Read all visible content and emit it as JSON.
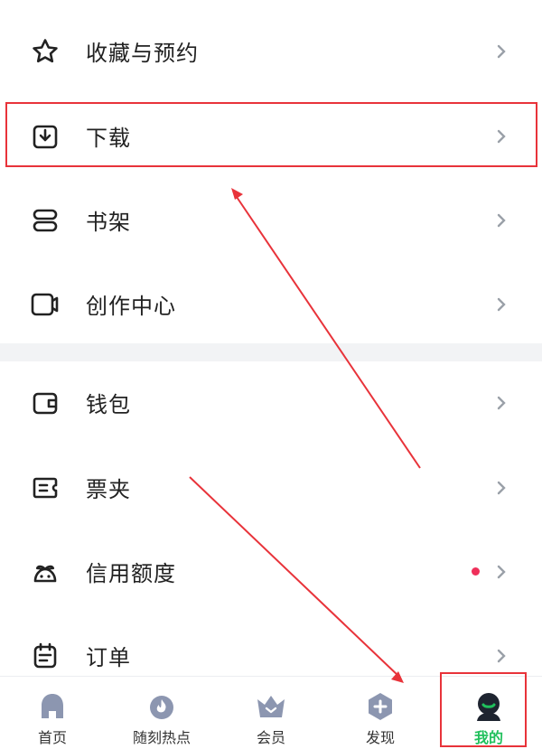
{
  "menu": {
    "items": [
      {
        "label": "收藏与预约",
        "icon": "star-icon"
      },
      {
        "label": "下载",
        "icon": "download-icon"
      },
      {
        "label": "书架",
        "icon": "bookshelf-icon"
      },
      {
        "label": "创作中心",
        "icon": "creator-icon"
      },
      {
        "label": "钱包",
        "icon": "wallet-icon"
      },
      {
        "label": "票夹",
        "icon": "ticket-icon"
      },
      {
        "label": "信用额度",
        "icon": "credit-icon"
      },
      {
        "label": "订单",
        "icon": "order-icon"
      }
    ]
  },
  "tabbar": {
    "tabs": [
      {
        "label": "首页",
        "icon": "home-icon"
      },
      {
        "label": "随刻热点",
        "icon": "hot-icon"
      },
      {
        "label": "会员",
        "icon": "vip-crown-icon"
      },
      {
        "label": "发现",
        "icon": "discover-icon"
      },
      {
        "label": "我的",
        "icon": "profile-icon"
      }
    ],
    "active": "我的"
  },
  "colors": {
    "accent_green": "#20c05c",
    "highlight_red": "#e8333a",
    "badge_dot": "#ef2f5a",
    "tab_icon_gray": "#8c96b0"
  }
}
